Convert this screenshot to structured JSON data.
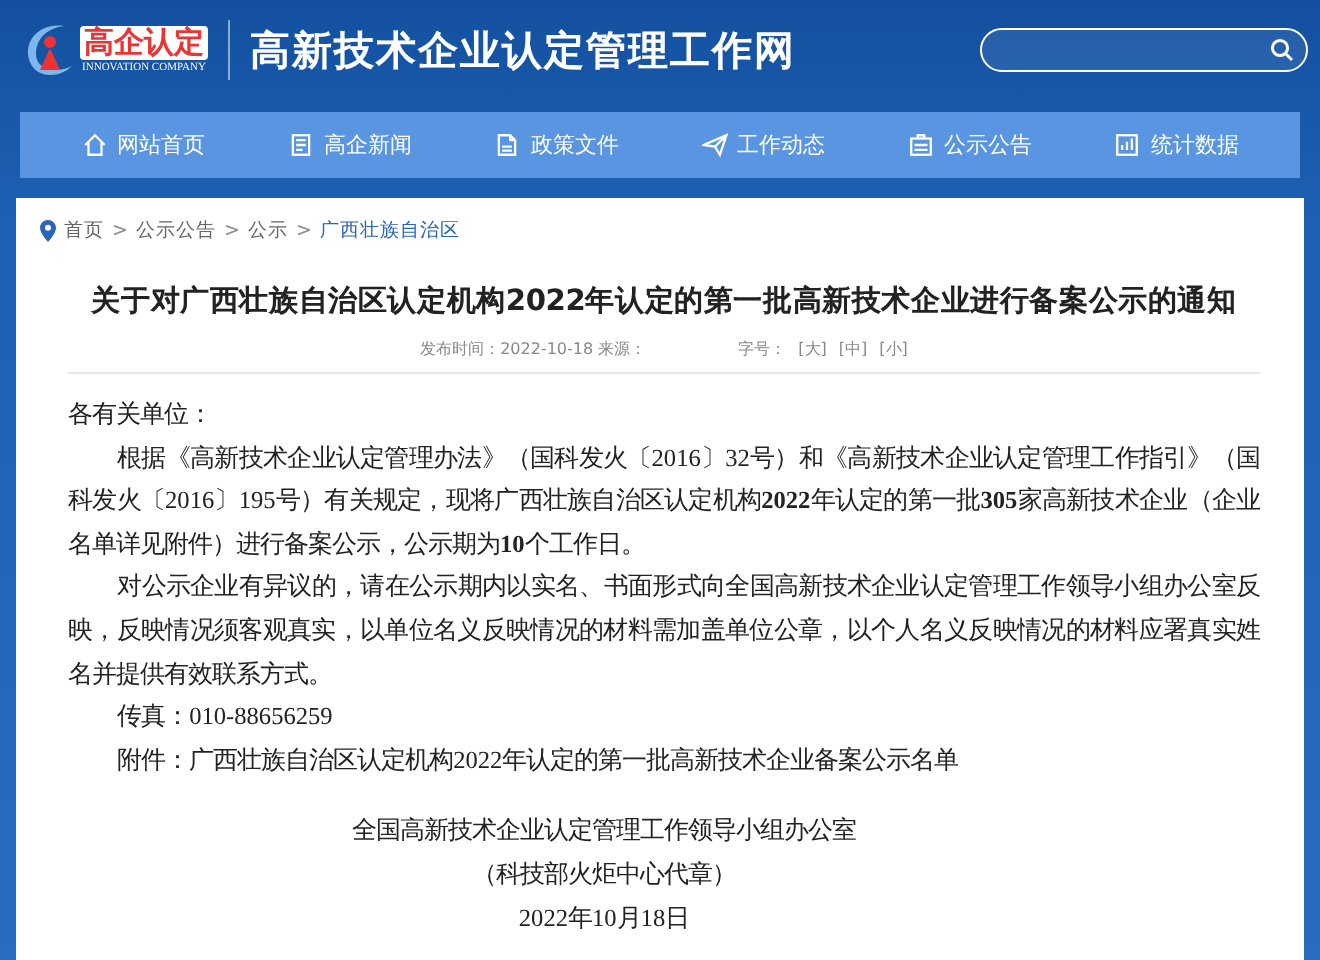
{
  "header": {
    "logo_text": "高企认定",
    "logo_subtext": "INNOVATION COMPANY",
    "site_title": "高新技术企业认定管理工作网"
  },
  "nav": [
    {
      "label": "网站首页"
    },
    {
      "label": "高企新闻"
    },
    {
      "label": "政策文件"
    },
    {
      "label": "工作动态"
    },
    {
      "label": "公示公告"
    },
    {
      "label": "统计数据"
    }
  ],
  "breadcrumb": {
    "separator": ">",
    "items": [
      {
        "label": "首页",
        "current": false
      },
      {
        "label": "公示公告",
        "current": false
      },
      {
        "label": "公示",
        "current": false
      },
      {
        "label": "广西壮族自治区",
        "current": true
      }
    ]
  },
  "article": {
    "title": "关于对广西壮族自治区认定机构2022年认定的第一批高新技术企业进行备案公示的通知",
    "meta": "发布时间：2022-10-18 来源：",
    "font_size_label": "字号：",
    "font_sizes": [
      "[大]",
      "[中]",
      "[小]"
    ],
    "blocks": [
      {
        "kind": "salutation",
        "text": "各有关单位："
      },
      {
        "kind": "paragraph",
        "text": "根据《高新技术企业认定管理办法》（国科发火〔2016〕32号）和《高新技术企业认定管理工作指引》（国科发火〔2016〕195号）有关规定，现将广西壮族自治区认定机构**2022**年认定的第一批**305**家高新技术企业（企业名单详见附件）进行备案公示，公示期为**10**个工作日。"
      },
      {
        "kind": "paragraph",
        "text": "对公示企业有异议的，请在公示期内以实名、书面形式向全国高新技术企业认定管理工作领导小组办公室反映，反映情况须客观真实，以单位名义反映情况的材料需加盖单位公章，以个人名义反映情况的材料应署真实姓名并提供有效联系方式。"
      },
      {
        "kind": "paragraph",
        "text": "传真：010-88656259"
      },
      {
        "kind": "paragraph",
        "text": "附件：广西壮族自治区认定机构2022年认定的第一批高新技术企业备案公示名单"
      },
      {
        "kind": "signature",
        "text": "全国高新技术企业认定管理工作领导小组办公室"
      },
      {
        "kind": "signature",
        "text": "（科技部火炬中心代章）"
      },
      {
        "kind": "signature",
        "text": "2022年10月18日"
      }
    ]
  }
}
